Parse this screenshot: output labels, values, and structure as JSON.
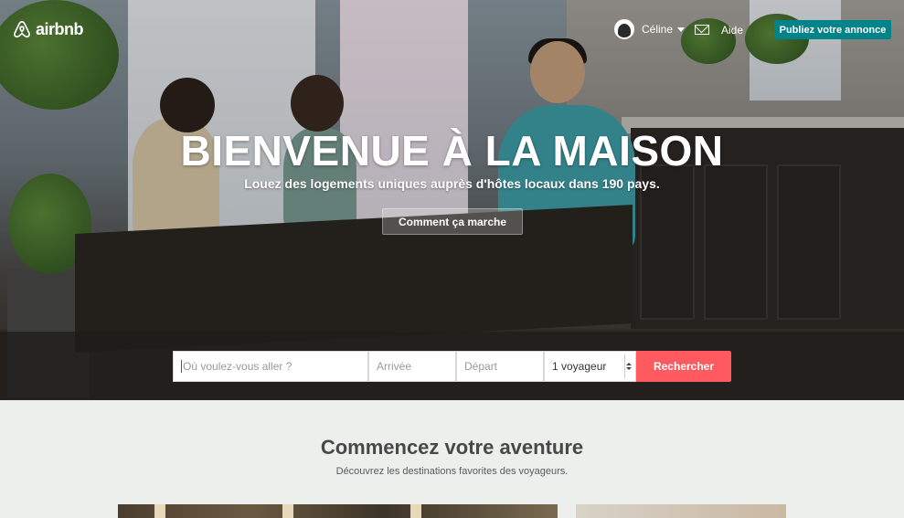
{
  "header": {
    "logo_text": "airbnb",
    "user_name": "Céline",
    "help_label": "Aide",
    "publish_label": "Publiez votre annonce"
  },
  "hero": {
    "title": "BIENVENUE À LA MAISON",
    "subtitle": "Louez des logements uniques auprès d'hôtes locaux dans 190 pays.",
    "how_it_works_label": "Comment ça marche"
  },
  "search": {
    "where_placeholder": "Où voulez-vous aller ?",
    "checkin_placeholder": "Arrivée",
    "checkout_placeholder": "Départ",
    "guests_value": "1 voyageur",
    "search_label": "Rechercher"
  },
  "discover": {
    "title": "Commencez votre aventure",
    "subtitle": "Découvrez les destinations favorites des voyageurs."
  },
  "colors": {
    "brand_red": "#ff5a5f",
    "publish_teal": "#00848a"
  },
  "icons": [
    "airbnb-logo-icon",
    "avatar",
    "chevron-down-icon",
    "mail-icon",
    "stepper-icon"
  ]
}
